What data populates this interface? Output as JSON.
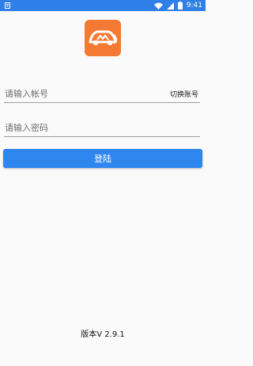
{
  "status_bar": {
    "time": "9:41",
    "icons": [
      "notification-icon",
      "wifi-icon",
      "signal-icon",
      "battery-icon"
    ]
  },
  "app": {
    "logo_icon": "car-wrench-logo"
  },
  "form": {
    "account_placeholder": "请输入帐号",
    "switch_account_label": "切换账号",
    "password_placeholder": "请输入密码",
    "login_label": "登陆"
  },
  "footer": {
    "version_text": "版本V 2.9.1"
  },
  "colors": {
    "status_bar": "#2e7fe8",
    "logo_background": "#f47a34",
    "primary_button": "#2f86ee"
  }
}
